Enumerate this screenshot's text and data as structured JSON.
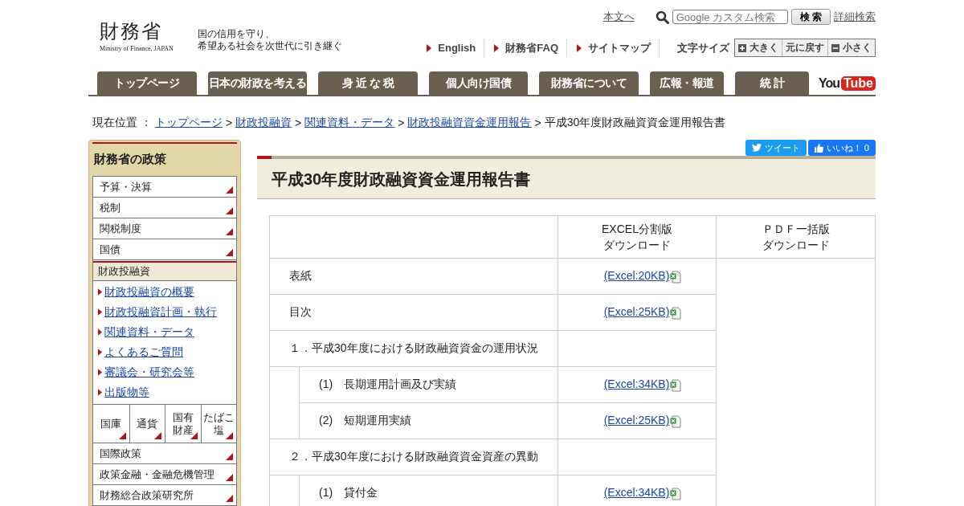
{
  "header": {
    "logo_title": "財務省",
    "logo_subtitle": "Ministry of Finance, JAPAN",
    "tagline": [
      "国の信用を守り、",
      "希望ある社会を次世代に引き継ぐ"
    ],
    "skip_link": "本文へ",
    "search": {
      "placeholder": "Google カスタム検索",
      "button": "検 索"
    },
    "advanced_search": "詳細検索",
    "links": [
      "English",
      "財務省FAQ",
      "サイトマップ"
    ],
    "font_size": {
      "label": "文字サイズ",
      "buttons": [
        {
          "label": "大きく",
          "kind": "plus"
        },
        {
          "label": "元に戻す",
          "kind": "plain"
        },
        {
          "label": "小さく",
          "kind": "minus"
        }
      ]
    }
  },
  "nav": {
    "tabs": [
      "トップページ",
      "日本の財政を考える",
      "身 近 な 税",
      "個人向け国債",
      "財務省について",
      "広報・報道",
      "統 計"
    ],
    "youtube": [
      "You",
      "Tube"
    ]
  },
  "breadcrumb": {
    "label": "現在位置 ：",
    "links": [
      "トップページ",
      "財政投融資",
      "関連資料・データ",
      "財政投融資資金運用報告"
    ],
    "separator": ">",
    "current": "平成30年度財政融資資金運用報告書"
  },
  "sidebar": {
    "title": "財務省の政策",
    "items": [
      {
        "label": "予算・決算"
      },
      {
        "label": "税制"
      },
      {
        "label": "関税制度"
      },
      {
        "label": "国債"
      }
    ],
    "section": {
      "label": "財政投融資",
      "links": [
        "財政投融資の概要",
        "財政投融資計画・執行",
        "関連資料・データ",
        "よくあるご質問",
        "審議会・研究会等",
        "出版物等"
      ]
    },
    "grid": [
      [
        "国庫"
      ],
      [
        "通貨"
      ],
      [
        "国有",
        "財産"
      ],
      [
        "たばこ",
        "塩"
      ]
    ],
    "more_items": [
      {
        "label": "国際政策"
      },
      {
        "label": "政策金融・金融危機管理"
      },
      {
        "label": "財務総合政策研究所"
      }
    ]
  },
  "social": {
    "tweet": "ツイート",
    "like": "いいね！ 0"
  },
  "page_title": "平成30年度財政融資資金運用報告書",
  "table": {
    "columns": [
      [
        "EXCEL分割版",
        "ダウンロード"
      ],
      [
        "ＰＤＦ一括版",
        "ダウンロード"
      ]
    ],
    "rows": [
      {
        "label": "表紙",
        "kind": "item",
        "excel": "(Excel:20KB)"
      },
      {
        "label": "目次",
        "kind": "item",
        "excel": "(Excel:25KB)"
      },
      {
        "label": "１．平成30年度における財政融資資金の運用状況",
        "kind": "heading"
      },
      {
        "label": "(1)　長期運用計画及び実績",
        "kind": "sub",
        "excel": "(Excel:34KB)"
      },
      {
        "label": "(2)　短期運用実績",
        "kind": "sub",
        "excel": "(Excel:25KB)"
      },
      {
        "label": "２．平成30年度における財政融資資金資産の異動",
        "kind": "heading"
      },
      {
        "label": "(1)　貸付金",
        "kind": "sub",
        "excel": "(Excel:34KB)"
      }
    ]
  }
}
